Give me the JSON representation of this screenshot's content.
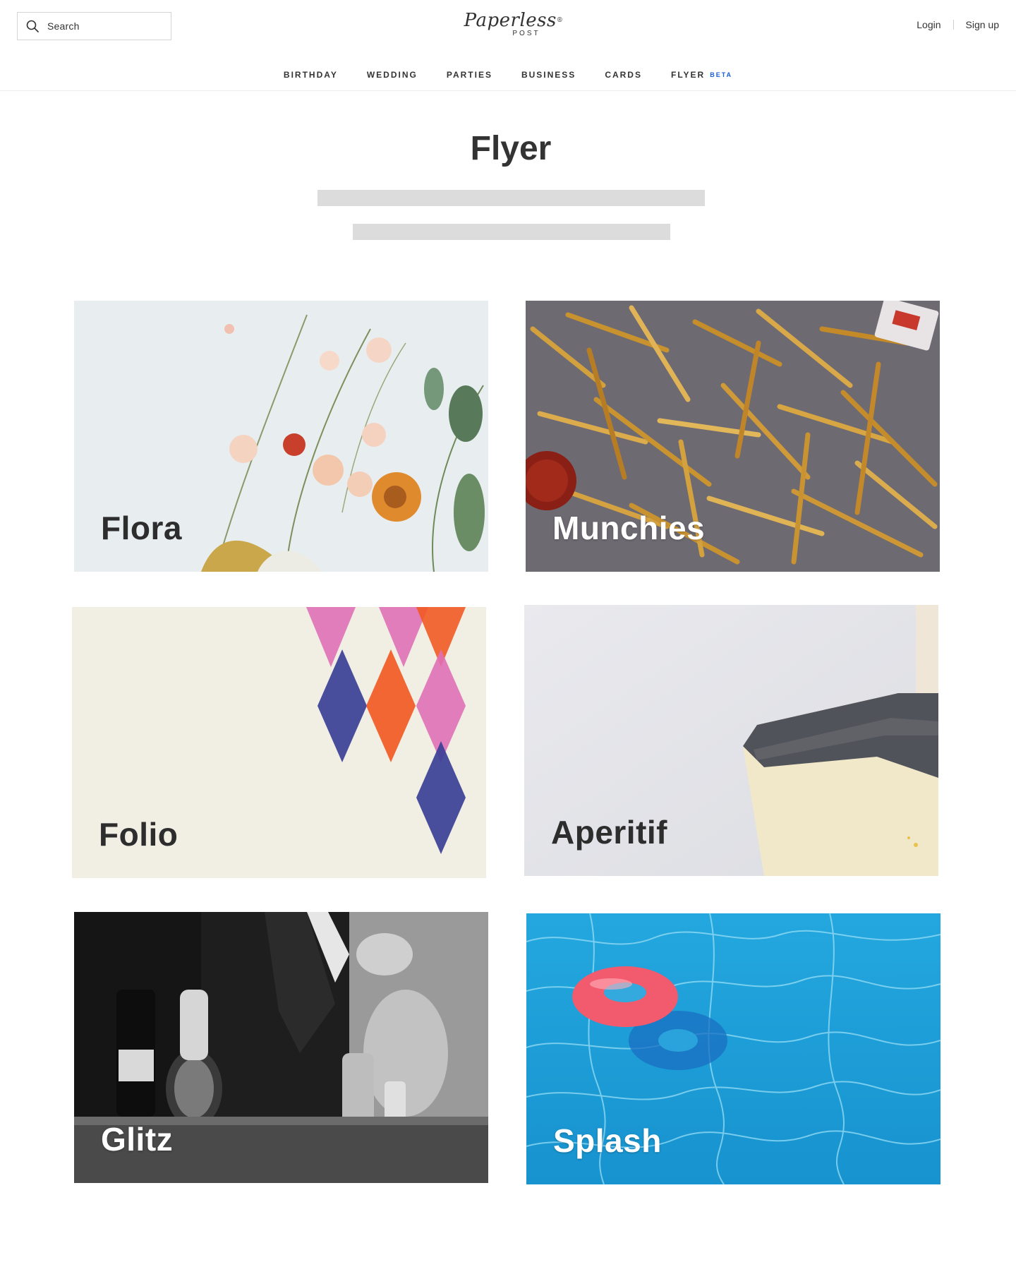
{
  "header": {
    "search": {
      "placeholder": "Search"
    },
    "logo": {
      "script": "Paperless",
      "sub": "POST",
      "mark": "®"
    },
    "auth": {
      "login": "Login",
      "signup": "Sign up"
    }
  },
  "nav": {
    "items": [
      {
        "label": "BIRTHDAY"
      },
      {
        "label": "WEDDING"
      },
      {
        "label": "PARTIES"
      },
      {
        "label": "BUSINESS"
      },
      {
        "label": "CARDS"
      },
      {
        "label": "FLYER",
        "badge": "BETA"
      }
    ]
  },
  "page": {
    "title": "Flyer"
  },
  "collections": [
    {
      "name": "Flora",
      "label_color": "dark"
    },
    {
      "name": "Munchies",
      "label_color": "light"
    },
    {
      "name": "Folio",
      "label_color": "dark"
    },
    {
      "name": "Aperitif",
      "label_color": "dark"
    },
    {
      "name": "Glitz",
      "label_color": "light"
    },
    {
      "name": "Splash",
      "label_color": "light"
    }
  ],
  "colors": {
    "text": "#333333",
    "beta_accent": "#1a5fd6",
    "skeleton": "#dcdcdc"
  }
}
